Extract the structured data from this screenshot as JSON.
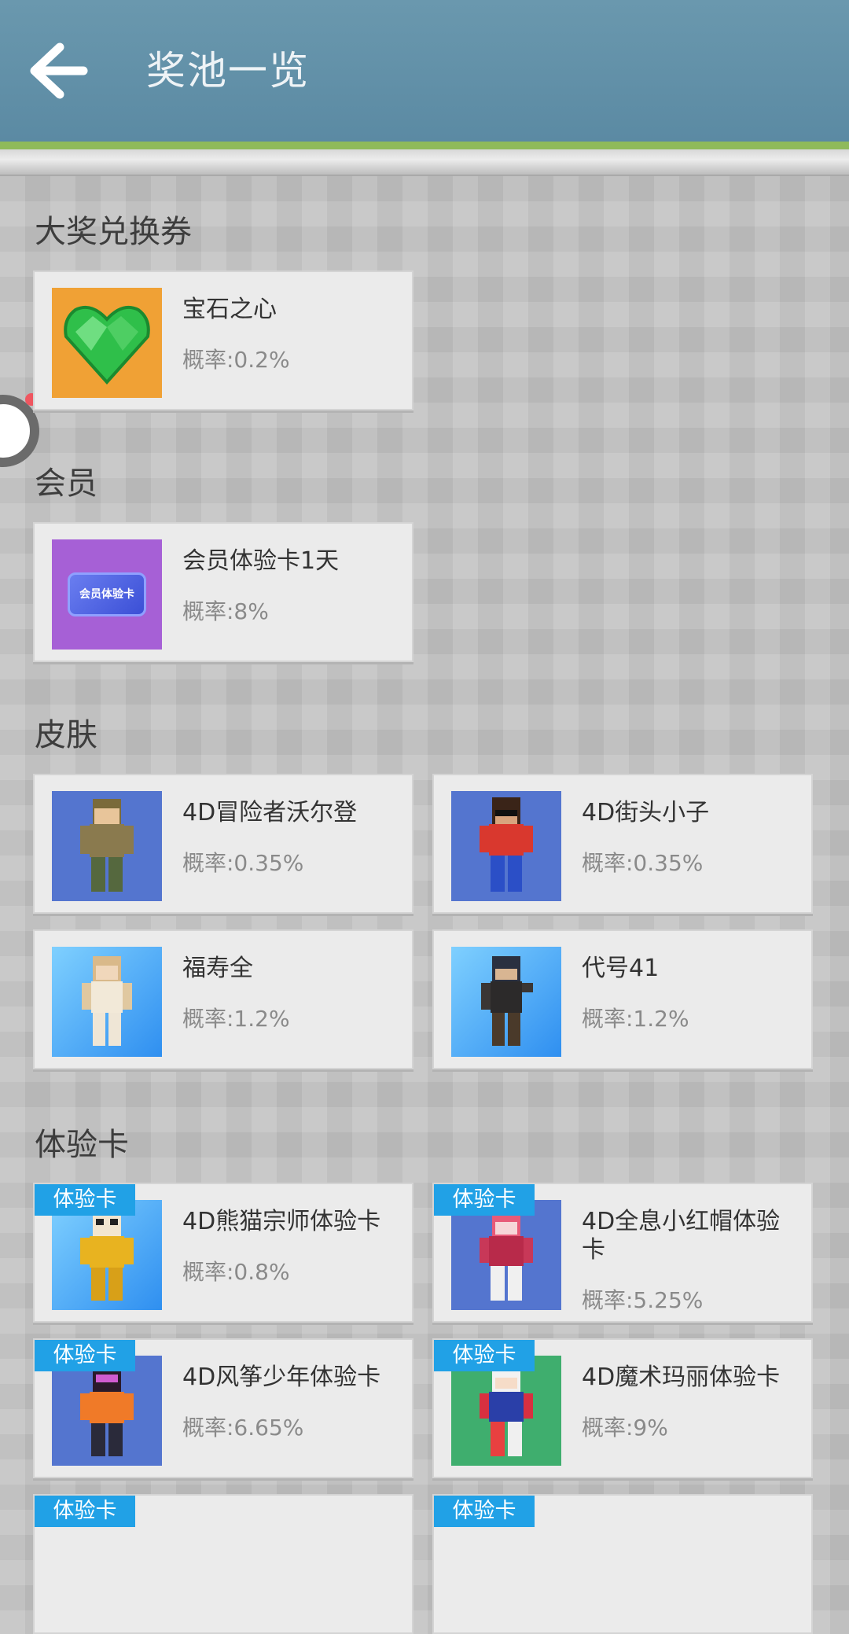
{
  "header": {
    "title": "奖池一览"
  },
  "sections": [
    {
      "title": "大奖兑换券",
      "items": [
        {
          "name": "宝石之心",
          "rate": "概率:0.2%"
        }
      ]
    },
    {
      "title": "会员",
      "items": [
        {
          "name": "会员体验卡1天",
          "rate": "概率:8%",
          "thumb_text": "会员体验卡"
        }
      ]
    },
    {
      "title": "皮肤",
      "items": [
        {
          "name": "4D冒险者沃尔登",
          "rate": "概率:0.35%"
        },
        {
          "name": "4D街头小子",
          "rate": "概率:0.35%"
        },
        {
          "name": "福寿全",
          "rate": "概率:1.2%"
        },
        {
          "name": "代号41",
          "rate": "概率:1.2%"
        }
      ]
    },
    {
      "title": "体验卡",
      "items": [
        {
          "badge": "体验卡",
          "name": "4D熊猫宗师体验卡",
          "rate": "概率:0.8%"
        },
        {
          "badge": "体验卡",
          "name": "4D全息小红帽体验卡",
          "rate": "概率:5.25%"
        },
        {
          "badge": "体验卡",
          "name": "4D风筝少年体验卡",
          "rate": "概率:6.65%"
        },
        {
          "badge": "体验卡",
          "name": "4D魔术玛丽体验卡",
          "rate": "概率:9%"
        },
        {
          "badge": "体验卡",
          "name": "",
          "rate": ""
        },
        {
          "badge": "体验卡",
          "name": "",
          "rate": ""
        }
      ]
    }
  ],
  "colors": {
    "header": "#5b8aa3",
    "accent_bar": "#8fba5a",
    "badge": "#21a1e6"
  }
}
